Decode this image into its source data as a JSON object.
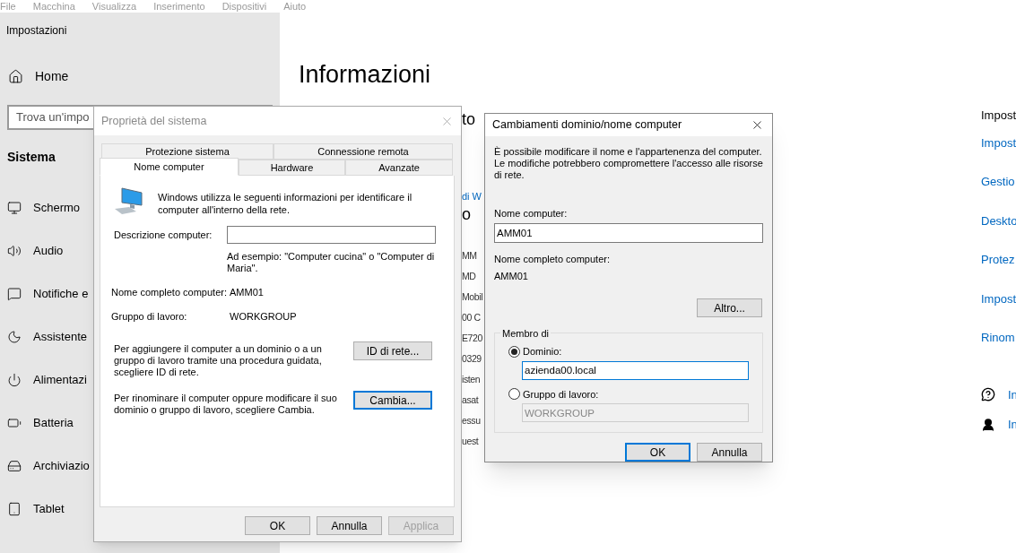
{
  "menu_bar": [
    "File",
    "Macchina",
    "Visualizza",
    "Inserimento",
    "Dispositivi",
    "Aiuto"
  ],
  "settings": {
    "title": "Impostazioni",
    "home": "Home",
    "search": {
      "placeholder": "Trova un'impo"
    },
    "section": "Sistema",
    "nav": [
      {
        "label": "Schermo"
      },
      {
        "label": "Audio"
      },
      {
        "label": "Notifiche e"
      },
      {
        "label": "Assistente"
      },
      {
        "label": "Alimentazi"
      },
      {
        "label": "Batteria"
      },
      {
        "label": "Archiviazio"
      },
      {
        "label": "Tablet"
      }
    ],
    "heading": "Informazioni",
    "fragments": [
      {
        "kind": "heading",
        "text": "to"
      },
      {
        "kind": "link",
        "text": "di W"
      },
      {
        "kind": "heading",
        "text": "o"
      },
      {
        "kind": "text",
        "text": "MM"
      },
      {
        "kind": "text",
        "text": "MD"
      },
      {
        "kind": "text",
        "text": "Mobil"
      },
      {
        "kind": "text",
        "text": "00 C"
      },
      {
        "kind": "text",
        "text": "E720"
      },
      {
        "kind": "text",
        "text": "0329"
      },
      {
        "kind": "text",
        "text": "isten"
      },
      {
        "kind": "text",
        "text": "asat"
      },
      {
        "kind": "text",
        "text": "essu"
      },
      {
        "kind": "text",
        "text": "uest"
      }
    ],
    "related_title": "Impost",
    "related_links": [
      "Impost",
      "Gestio",
      "Deskto",
      "Protez",
      "Impost",
      "Rinom"
    ],
    "help_links": [
      "In",
      "In"
    ]
  },
  "system_properties": {
    "title": "Proprietà del sistema",
    "tabs_top": [
      {
        "label": "Protezione sistema",
        "selected": false
      },
      {
        "label": "Connessione remota",
        "selected": false
      }
    ],
    "tabs_bottom": [
      {
        "label": "Nome computer",
        "selected": true
      },
      {
        "label": "Hardware",
        "selected": false
      },
      {
        "label": "Avanzate",
        "selected": false
      }
    ],
    "intro": "Windows utilizza le seguenti informazioni per identificare il computer all'interno della rete.",
    "description_label": "Descrizione computer:",
    "description_hint": "Ad esempio: \"Computer cucina\" o \"Computer di Maria\".",
    "full_name_label": "Nome completo computer:",
    "full_name": "AMM01",
    "workgroup_label": "Gruppo di lavoro:",
    "workgroup": "WORKGROUP",
    "actions": [
      {
        "text": "Per aggiungere il computer a un dominio o a un gruppo di lavoro tramite una procedura guidata, scegliere ID di rete.",
        "button": "ID di rete...",
        "default": false
      },
      {
        "text": "Per rinominare il computer oppure modificare il suo dominio o gruppo di lavoro, scegliere Cambia.",
        "button": "Cambia...",
        "default": true
      }
    ],
    "buttons": [
      {
        "label": "OK",
        "disabled": false
      },
      {
        "label": "Annulla",
        "disabled": false
      },
      {
        "label": "Applica",
        "disabled": true
      }
    ]
  },
  "domain_dialog": {
    "title": "Cambiamenti dominio/nome computer",
    "intro": "È possibile modificare il nome e l'appartenenza del computer. Le modifiche potrebbero compromettere l'accesso alle risorse di rete.",
    "name_label": "Nome computer:",
    "name_value": "AMM01",
    "full_name_label": "Nome completo computer:",
    "full_name": "AMM01",
    "more_button": "Altro...",
    "member_of": "Membro di",
    "options": [
      {
        "label": "Dominio:",
        "selected": true,
        "value": "azienda00.local",
        "focused": true,
        "disabled": false
      },
      {
        "label": "Gruppo di lavoro:",
        "selected": false,
        "value": "WORKGROUP",
        "focused": false,
        "disabled": true
      }
    ],
    "buttons": [
      {
        "label": "OK",
        "default": true
      },
      {
        "label": "Annulla",
        "default": false
      }
    ]
  }
}
